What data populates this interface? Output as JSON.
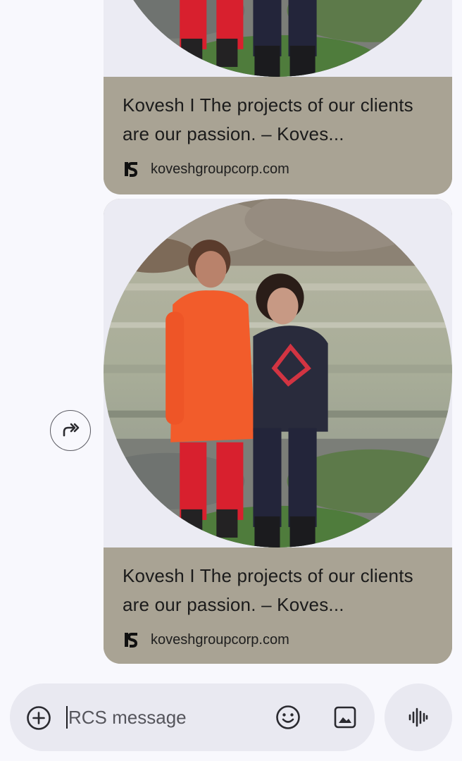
{
  "messages": [
    {
      "title": "Kovesh  I  The projects of our clients are our passion. – Koves...",
      "domain": "koveshgroupcorp.com",
      "image_icon": "circular-photo-two-children"
    },
    {
      "title": "Kovesh  I  The projects of our clients are our passion. – Koves...",
      "domain": "koveshgroupcorp.com",
      "image_icon": "circular-photo-two-children"
    }
  ],
  "composer": {
    "placeholder": "RCS message",
    "add_icon": "plus-circle-icon",
    "emoji_icon": "emoji-icon",
    "gallery_icon": "gallery-icon"
  },
  "actions": {
    "forward_icon": "forward-icon",
    "voice_icon": "voice-waveform-icon"
  },
  "colors": {
    "background": "#f8f8fd",
    "card_info": "#a9a394",
    "composer": "#e9e9f1"
  }
}
